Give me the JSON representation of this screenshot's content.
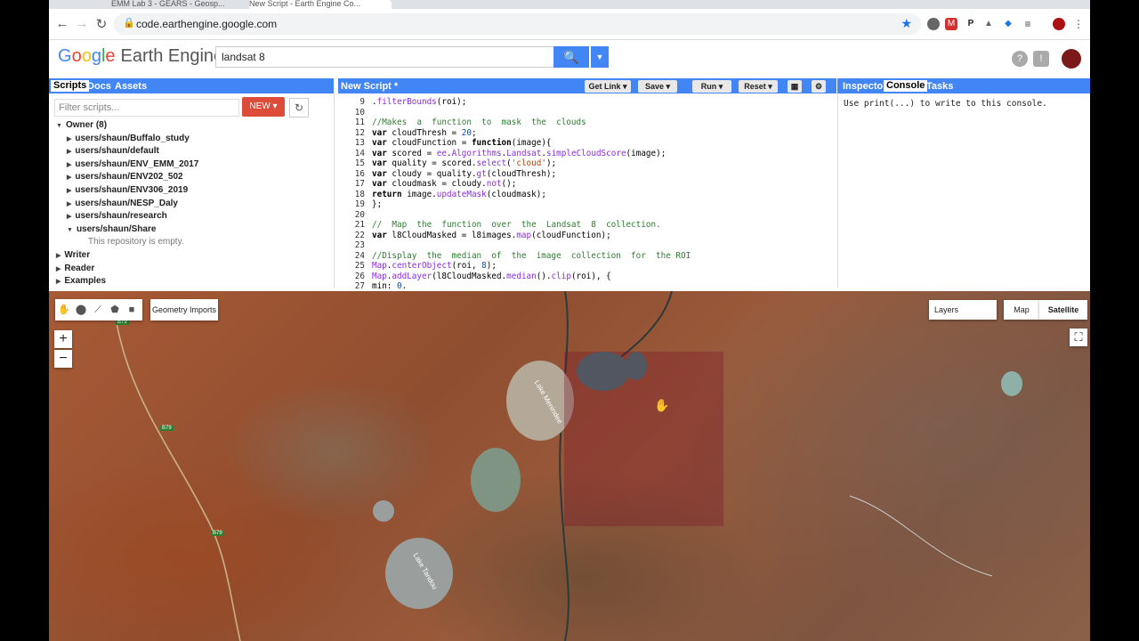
{
  "browser": {
    "tabs": [
      "EMM Lab 3 - GEARS - Geosp...",
      "New Script - Earth Engine Co..."
    ],
    "url": "code.earthengine.google.com",
    "colors": {
      "accent": "#1a73e8"
    }
  },
  "header": {
    "logo_google": [
      "G",
      "o",
      "o",
      "g",
      "l",
      "e"
    ],
    "logo_product": "Earth Engine",
    "search_value": "landsat 8"
  },
  "left_panel": {
    "tabs": [
      "Scripts",
      "Docs",
      "Assets"
    ],
    "filter_placeholder": "Filter scripts...",
    "new_label": "NEW",
    "tree": [
      {
        "label": "Owner  (8)",
        "indent": 0,
        "arrow": "down"
      },
      {
        "label": "users/shaun/Buffalo_study",
        "indent": 1,
        "arrow": "right"
      },
      {
        "label": "users/shaun/default",
        "indent": 1,
        "arrow": "right"
      },
      {
        "label": "users/shaun/ENV_EMM_2017",
        "indent": 1,
        "arrow": "right"
      },
      {
        "label": "users/shaun/ENV202_502",
        "indent": 1,
        "arrow": "right"
      },
      {
        "label": "users/shaun/ENV306_2019",
        "indent": 1,
        "arrow": "right"
      },
      {
        "label": "users/shaun/NESP_Daly",
        "indent": 1,
        "arrow": "right"
      },
      {
        "label": "users/shaun/research",
        "indent": 1,
        "arrow": "right"
      },
      {
        "label": "users/shaun/Share",
        "indent": 1,
        "arrow": "down"
      },
      {
        "label": "This repository is empty.",
        "indent": 2,
        "arrow": "none"
      },
      {
        "label": "Writer",
        "indent": 0,
        "arrow": "right"
      },
      {
        "label": "Reader",
        "indent": 0,
        "arrow": "right"
      },
      {
        "label": "Examples",
        "indent": 0,
        "arrow": "right"
      }
    ]
  },
  "editor": {
    "title": "New Script *",
    "buttons": [
      "Get Link",
      "Save",
      "Run",
      "Reset"
    ],
    "lines": [
      {
        "n": "9",
        "t": ".filterBounds(roi);"
      },
      {
        "n": "10",
        "t": ""
      },
      {
        "n": "11",
        "t": "//Makes  a  function  to  mask  the  clouds"
      },
      {
        "n": "12",
        "t": "var cloudThresh = 20;"
      },
      {
        "n": "13",
        "t": "var cloudFunction = function(image){"
      },
      {
        "n": "14",
        "t": "var scored = ee.Algorithms.Landsat.simpleCloudScore(image);"
      },
      {
        "n": "15",
        "t": "var quality = scored.select('cloud');"
      },
      {
        "n": "16",
        "t": "var cloudy = quality.gt(cloudThresh);"
      },
      {
        "n": "17",
        "t": "var cloudmask = cloudy.not();"
      },
      {
        "n": "18",
        "t": "return image.updateMask(cloudmask);"
      },
      {
        "n": "19",
        "t": "};"
      },
      {
        "n": "20",
        "t": ""
      },
      {
        "n": "21",
        "t": "//  Map  the  function  over  the  Landsat  8  collection."
      },
      {
        "n": "22",
        "t": "var l8CloudMasked = l8images.map(cloudFunction);"
      },
      {
        "n": "23",
        "t": ""
      },
      {
        "n": "24",
        "t": "//Display  the  median  of  the  image  collection  for  the ROI"
      },
      {
        "n": "25",
        "t": "Map.centerObject(roi, 8);"
      },
      {
        "n": "26",
        "t": "Map.addLayer(l8CloudMasked.median().clip(roi), {"
      },
      {
        "n": "27",
        "t": "min: 0."
      }
    ]
  },
  "right_panel": {
    "tabs": [
      "Inspector",
      "Console",
      "Tasks"
    ],
    "console_message": "Use print(...) to write to this console."
  },
  "map": {
    "geometry_imports": "Geometry Imports",
    "zoom_in": "+",
    "zoom_out": "−",
    "layers": "Layers",
    "map_type": "Map",
    "satellite": "Satellite",
    "road_labels": [
      "B79",
      "B79",
      "B79"
    ],
    "lake_labels": [
      "Lake Menindee",
      "Lake Tandou"
    ]
  }
}
